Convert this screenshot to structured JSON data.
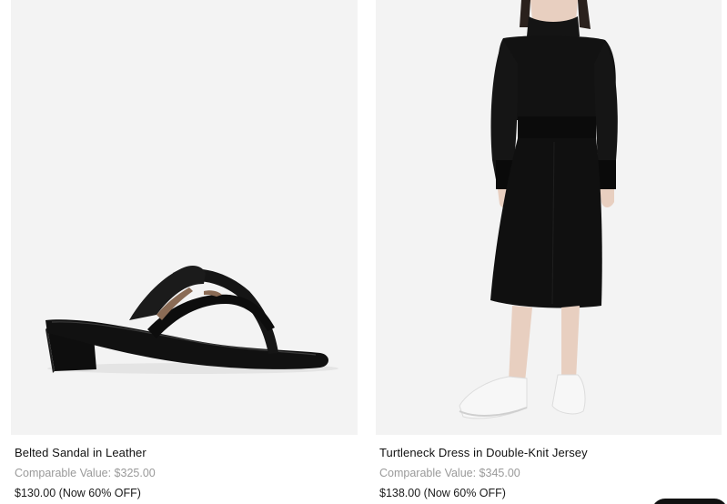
{
  "products": [
    {
      "name": "Belted Sandal in Leather",
      "comparable": "Comparable Value: $325.00",
      "price": "$130.00 (Now 60% OFF)",
      "image_icon": "sandal-image"
    },
    {
      "name": "Turtleneck Dress in Double-Knit Jersey",
      "comparable": "Comparable Value: $345.00",
      "price": "$138.00 (Now 60% OFF)",
      "image_icon": "dress-model-image"
    }
  ],
  "colors": {
    "image_bg": "#f3f3f3",
    "comparable_text": "#9a9a9a",
    "product_black": "#111111"
  }
}
